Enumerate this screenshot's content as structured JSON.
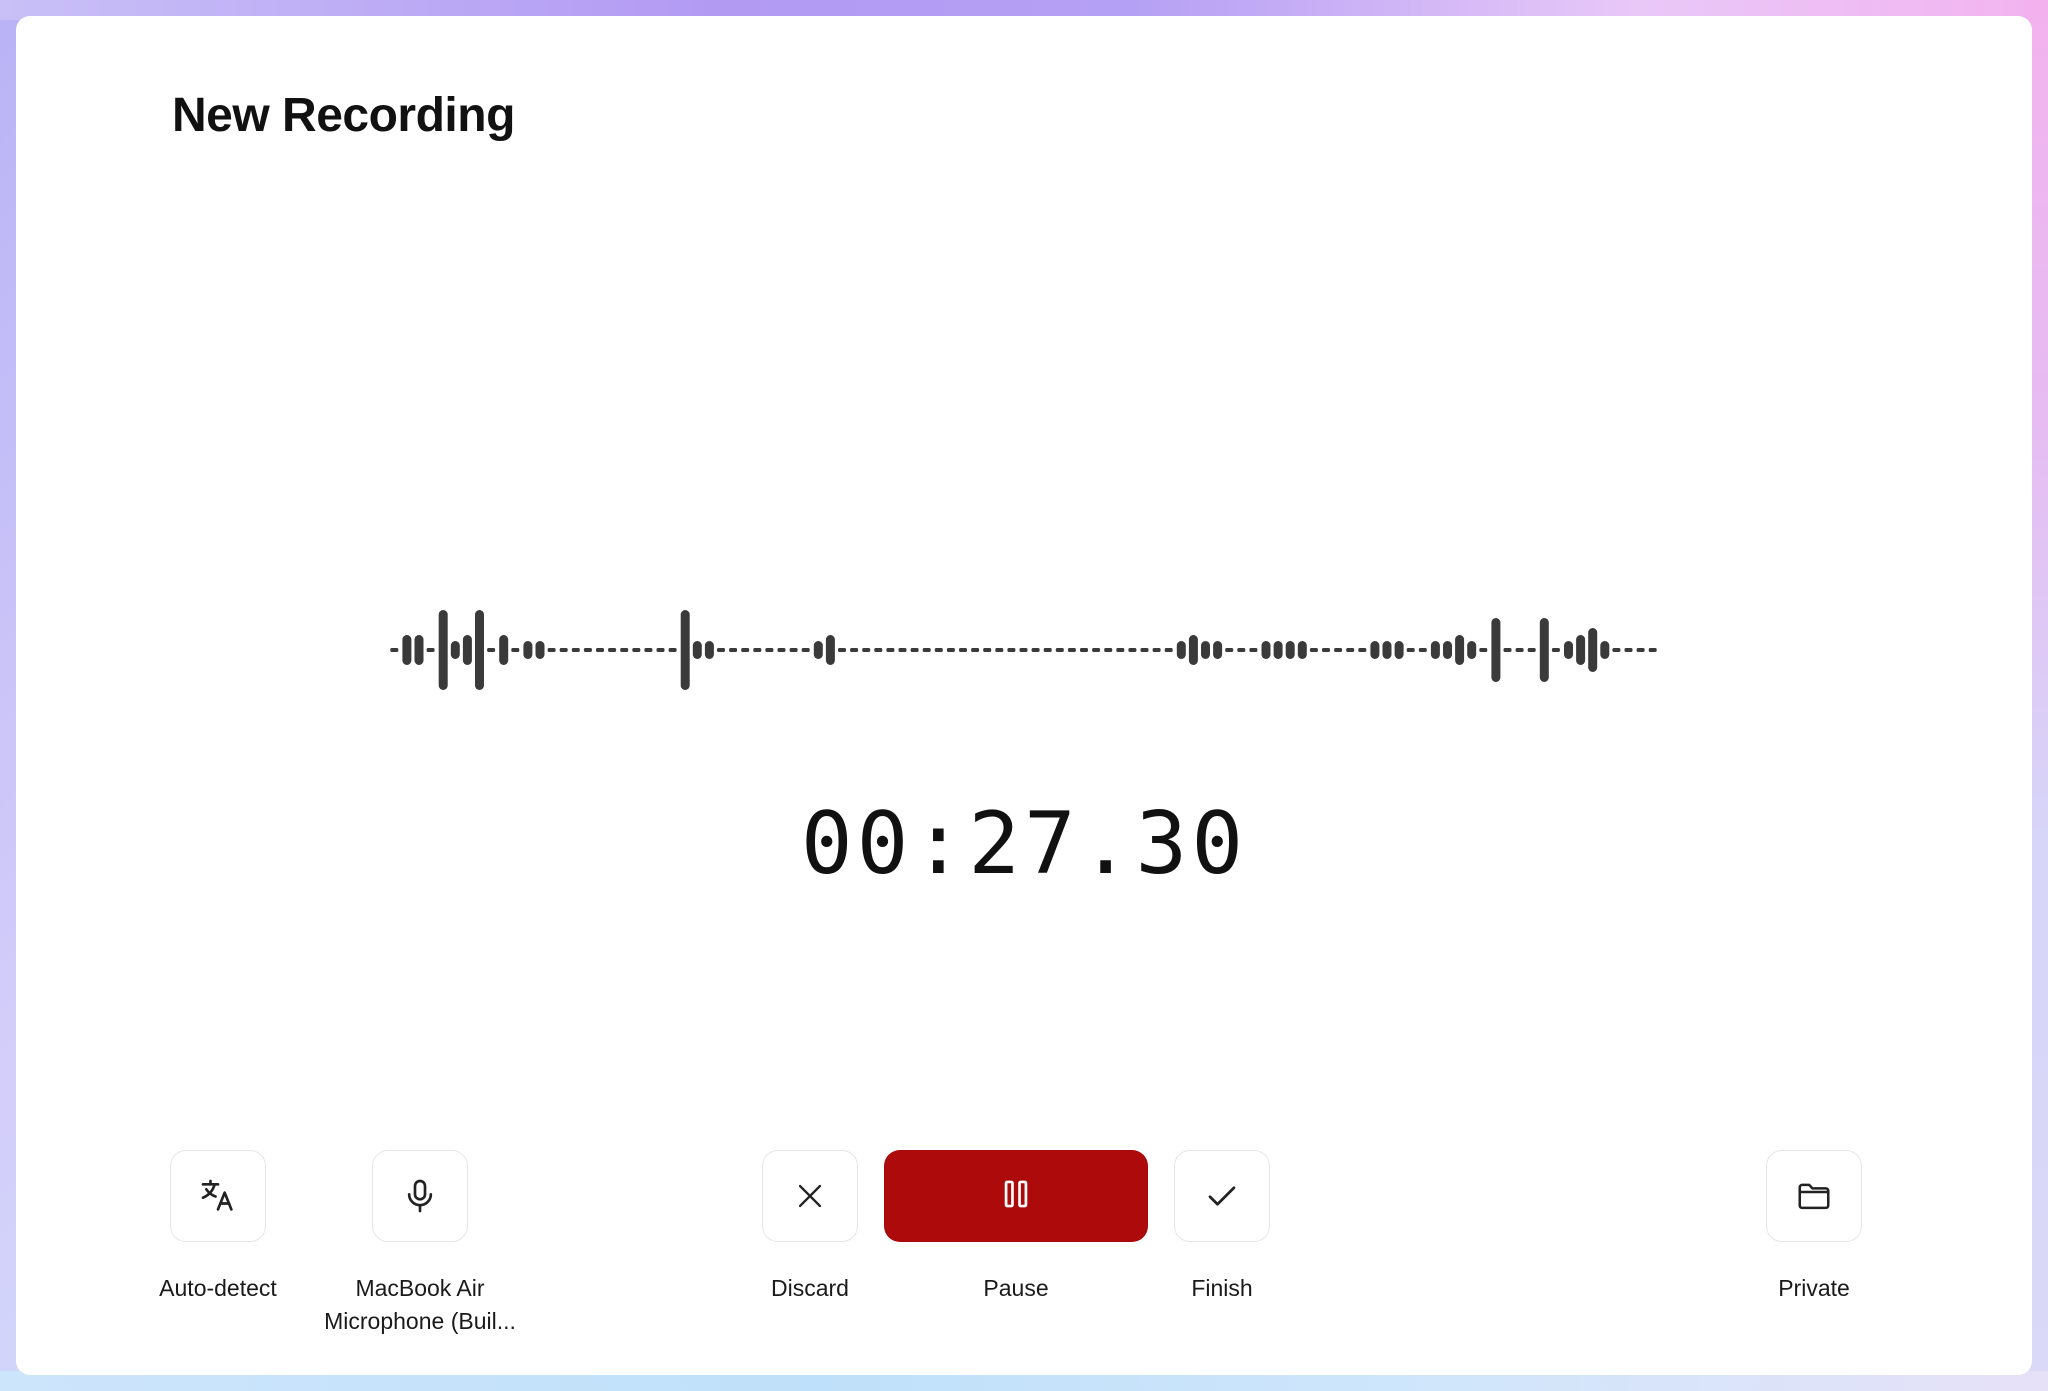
{
  "page": {
    "title": "New Recording"
  },
  "recorder": {
    "elapsed": "00:27.30",
    "state": "recording"
  },
  "controls": {
    "language": {
      "label": "Auto-detect",
      "icon": "translate-icon"
    },
    "microphone": {
      "label_line1": "MacBook Air",
      "label_line2": "Microphone (Buil...",
      "icon": "microphone-icon"
    },
    "discard": {
      "label": "Discard",
      "icon": "close-icon"
    },
    "pause": {
      "label": "Pause",
      "icon": "pause-icon",
      "color": "#ad0b0b"
    },
    "finish": {
      "label": "Finish",
      "icon": "check-icon"
    },
    "privacy": {
      "label": "Private",
      "icon": "folder-icon"
    }
  },
  "colors": {
    "waveform": "#3a3a3a",
    "accent": "#ad0b0b"
  }
}
